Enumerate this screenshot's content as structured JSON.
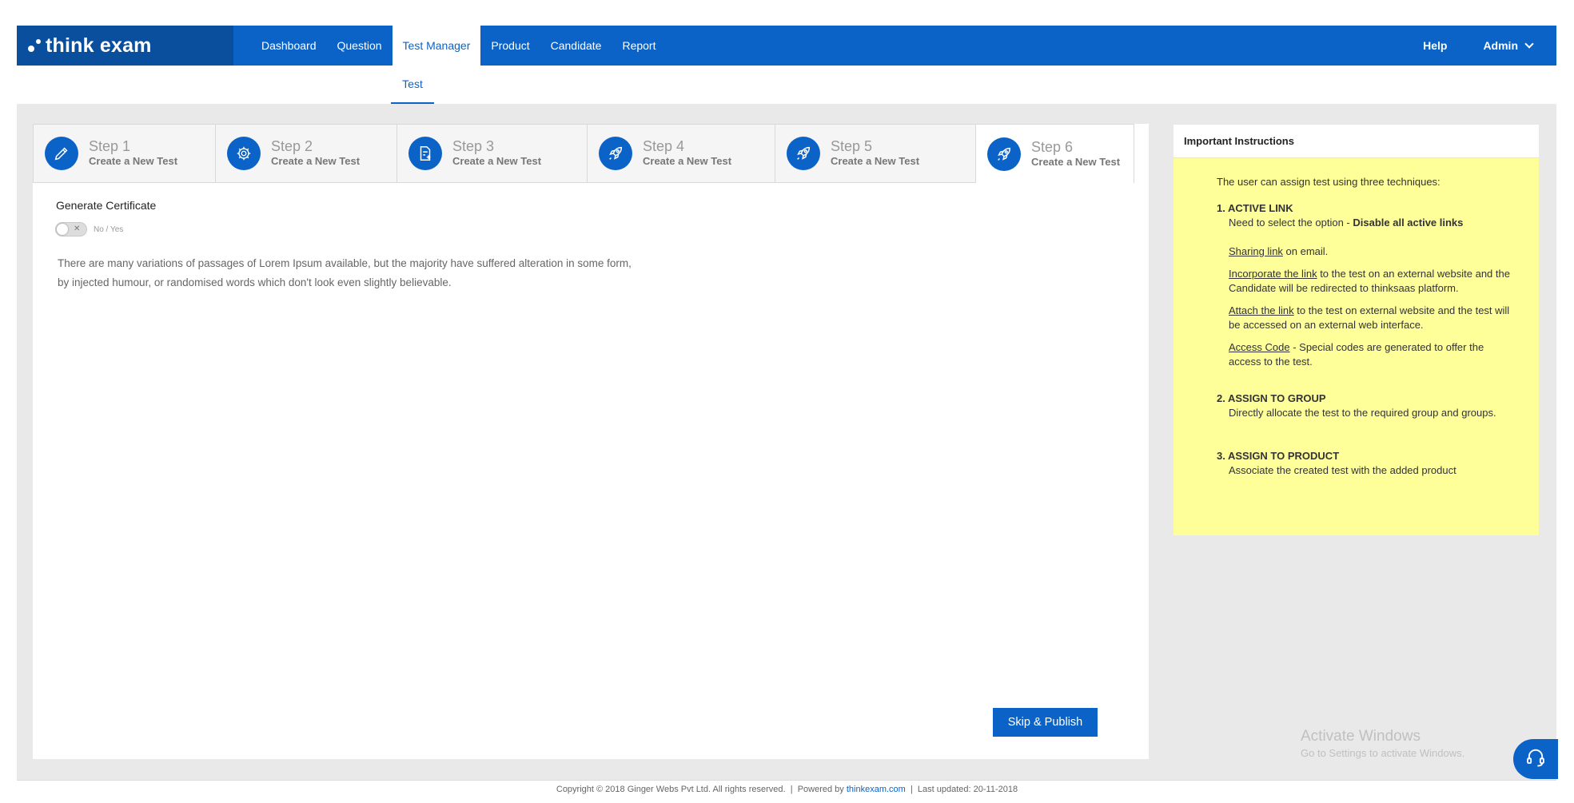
{
  "brand": {
    "name": "think exam",
    "logo_icon": "dots-logo-icon"
  },
  "nav": {
    "items": [
      {
        "label": "Dashboard"
      },
      {
        "label": "Question"
      },
      {
        "label": "Test Manager",
        "active": true
      },
      {
        "label": "Product"
      },
      {
        "label": "Candidate"
      },
      {
        "label": "Report"
      }
    ],
    "help": "Help",
    "user": "Admin"
  },
  "subnav": {
    "active": "Test"
  },
  "steps": [
    {
      "title": "Step 1",
      "subtitle": "Create a New Test",
      "icon": "pencil-icon"
    },
    {
      "title": "Step 2",
      "subtitle": "Create a New Test",
      "icon": "gear-icon"
    },
    {
      "title": "Step 3",
      "subtitle": "Create a New Test",
      "icon": "document-add-icon"
    },
    {
      "title": "Step 4",
      "subtitle": "Create a New Test",
      "icon": "rocket-icon"
    },
    {
      "title": "Step 5",
      "subtitle": "Create a New Test",
      "icon": "rocket-icon"
    },
    {
      "title": "Step 6",
      "subtitle": "Create a New Test",
      "icon": "rocket-icon",
      "active": true
    }
  ],
  "certificate": {
    "title": "Generate Certificate",
    "toggle_label": "No / Yes",
    "toggle_state": "off",
    "description_line1": "There are many variations of passages of Lorem Ipsum available, but the majority have suffered alteration in some form,",
    "description_line2": "by injected humour, or randomised words which don't look even slightly believable."
  },
  "publish_button": "Skip & Publish",
  "instructions": {
    "heading": "Important Instructions",
    "intro": "The user can assign test using three techniques:",
    "s1_title": "1. ACTIVE LINK",
    "s1_line_prefix": "Need to select the option - ",
    "s1_line_bold": "Disable all active links",
    "s1_sharing_link": "Sharing link",
    "s1_sharing_rest": " on email.",
    "s1_incorporate_link": "Incorporate the link",
    "s1_incorporate_rest": " to the test on an external website and the Candidate will be redirected to thinksaas platform.",
    "s1_attach_link": "Attach the link",
    "s1_attach_rest": " to the test on external website and the test will be accessed on an external web interface.",
    "s1_access_link": "Access Code",
    "s1_access_rest": " - Special codes are generated to offer the access to the test.",
    "s2_title": "2. ASSIGN TO GROUP",
    "s2_text": "Directly allocate the test to the required group and groups.",
    "s3_title": "3. ASSIGN TO PRODUCT",
    "s3_text": "Associate the created test with the added product"
  },
  "footer": {
    "copyright": "Copyright © 2018 Ginger Webs Pvt Ltd. All rights reserved.",
    "sep1": "  |  ",
    "powered_prefix": "Powered by ",
    "powered_link": "thinkexam.com",
    "sep2": "  |  ",
    "updated": "Last updated: 20-11-2018"
  },
  "watermark": {
    "line1": "Activate Windows",
    "line2": "Go to Settings to activate Windows."
  },
  "support_icon": "headset-icon",
  "colors": {
    "primary": "#0b63c8",
    "logo_bg": "#0a4f9e",
    "instructions_bg": "#ffff99",
    "page_bg": "#e9e9e9"
  }
}
